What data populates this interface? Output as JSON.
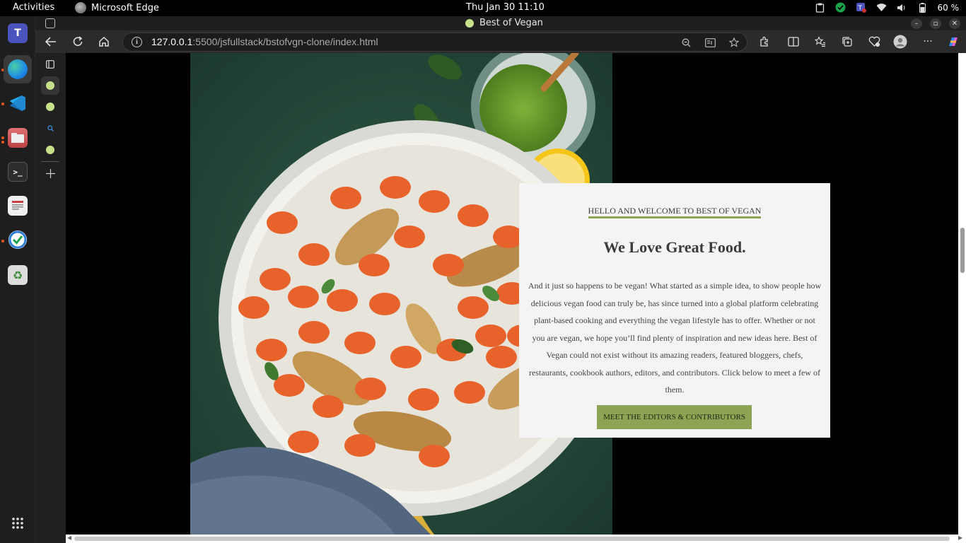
{
  "system_bar": {
    "activities": "Activities",
    "app_name": "Microsoft Edge",
    "clock": "Thu Jan 30  11:10",
    "battery": "60 %"
  },
  "dock": {
    "items": [
      {
        "name": "teams-icon",
        "color": "#4b53bc"
      },
      {
        "name": "edge-icon",
        "color": "#1e88e5"
      },
      {
        "name": "vscode-icon",
        "color": "#1f8ad2"
      },
      {
        "name": "files-icon",
        "color": "#c75050"
      },
      {
        "name": "terminal-icon",
        "color": "#333333"
      },
      {
        "name": "document-viewer-icon",
        "color": "#e0e0e0"
      },
      {
        "name": "security-app-icon",
        "color": "#2e7dd7"
      },
      {
        "name": "trash-icon",
        "color": "#7fa37f"
      }
    ]
  },
  "browser": {
    "window_title": "Best of Vegan",
    "url_host": "127.0.0.1",
    "url_rest": ":5500/jsfullstack/bstofvgn-clone/index.html"
  },
  "page": {
    "kicker": "HELLO AND WELCOME TO BEST OF VEGAN",
    "headline": "We Love Great Food.",
    "body": "And it just so happens to be vegan! What started as a simple idea, to show people how delicious vegan food can truly be, has since turned into a global platform celebrating plant-based cooking and everything the vegan lifestyle has to offer. Whether or not you are vegan, we hope you’ll find plenty of inspiration and new ideas here. Best of Vegan could not exist without its amazing readers, featured bloggers, chefs, restaurants, cookbook authors, editors, and contributors. Click below to meet a few of them.",
    "cta_label": "MEET THE EDITORS & CONTRIBUTORS",
    "accent_color": "#8da455"
  }
}
